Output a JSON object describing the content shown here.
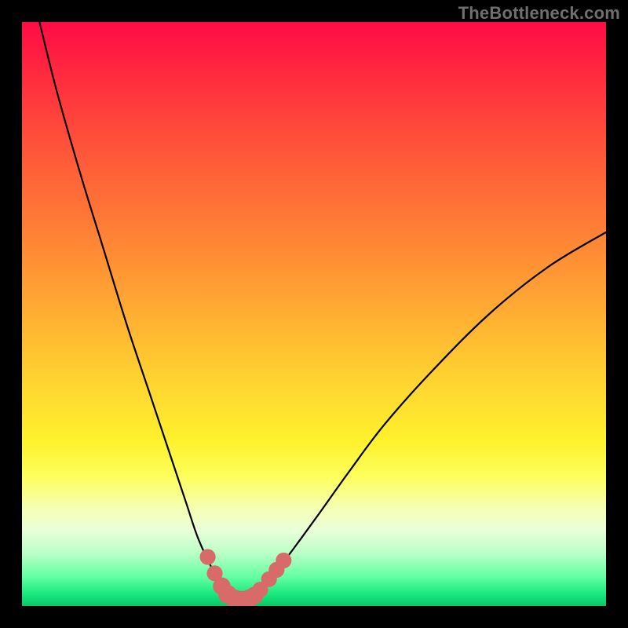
{
  "watermark": "TheBottleneck.com",
  "chart_data": {
    "type": "line",
    "title": "",
    "xlabel": "",
    "ylabel": "",
    "xlim": [
      0,
      100
    ],
    "ylim": [
      0,
      100
    ],
    "grid": false,
    "legend": false,
    "series": [
      {
        "name": "bottleneck-curve",
        "color": "#000000",
        "x": [
          3,
          6,
          10,
          14,
          18,
          22,
          25,
          28,
          30,
          32,
          33.5,
          35,
          36,
          37,
          38,
          39,
          40.5,
          42,
          44,
          47,
          51,
          56,
          62,
          70,
          80,
          90,
          100
        ],
        "y": [
          100,
          88,
          74,
          61,
          48,
          36,
          27,
          18,
          12,
          7.5,
          4.8,
          2.8,
          1.6,
          1.0,
          1.0,
          1.4,
          2.4,
          4.0,
          6.5,
          10.5,
          16,
          23,
          31,
          40,
          50,
          58,
          64
        ]
      }
    ],
    "markers": {
      "name": "highlight-band",
      "color": "#d86a6a",
      "points": [
        {
          "x": 31.8,
          "y": 8.4,
          "r": 1.1
        },
        {
          "x": 33.0,
          "y": 5.6,
          "r": 1.1
        },
        {
          "x": 34.2,
          "y": 3.4,
          "r": 1.4
        },
        {
          "x": 35.2,
          "y": 2.0,
          "r": 1.6
        },
        {
          "x": 36.4,
          "y": 1.2,
          "r": 1.6
        },
        {
          "x": 37.6,
          "y": 1.0,
          "r": 1.6
        },
        {
          "x": 38.8,
          "y": 1.2,
          "r": 1.6
        },
        {
          "x": 39.8,
          "y": 1.8,
          "r": 1.4
        },
        {
          "x": 40.8,
          "y": 2.8,
          "r": 1.1
        },
        {
          "x": 42.3,
          "y": 4.6,
          "r": 1.1
        },
        {
          "x": 43.6,
          "y": 6.2,
          "r": 1.1
        },
        {
          "x": 44.8,
          "y": 7.8,
          "r": 1.1
        }
      ]
    },
    "colors": {
      "background_top": "#ff0b46",
      "background_bottom": "#08c766",
      "curve": "#000000",
      "marker": "#d86a6a"
    }
  }
}
